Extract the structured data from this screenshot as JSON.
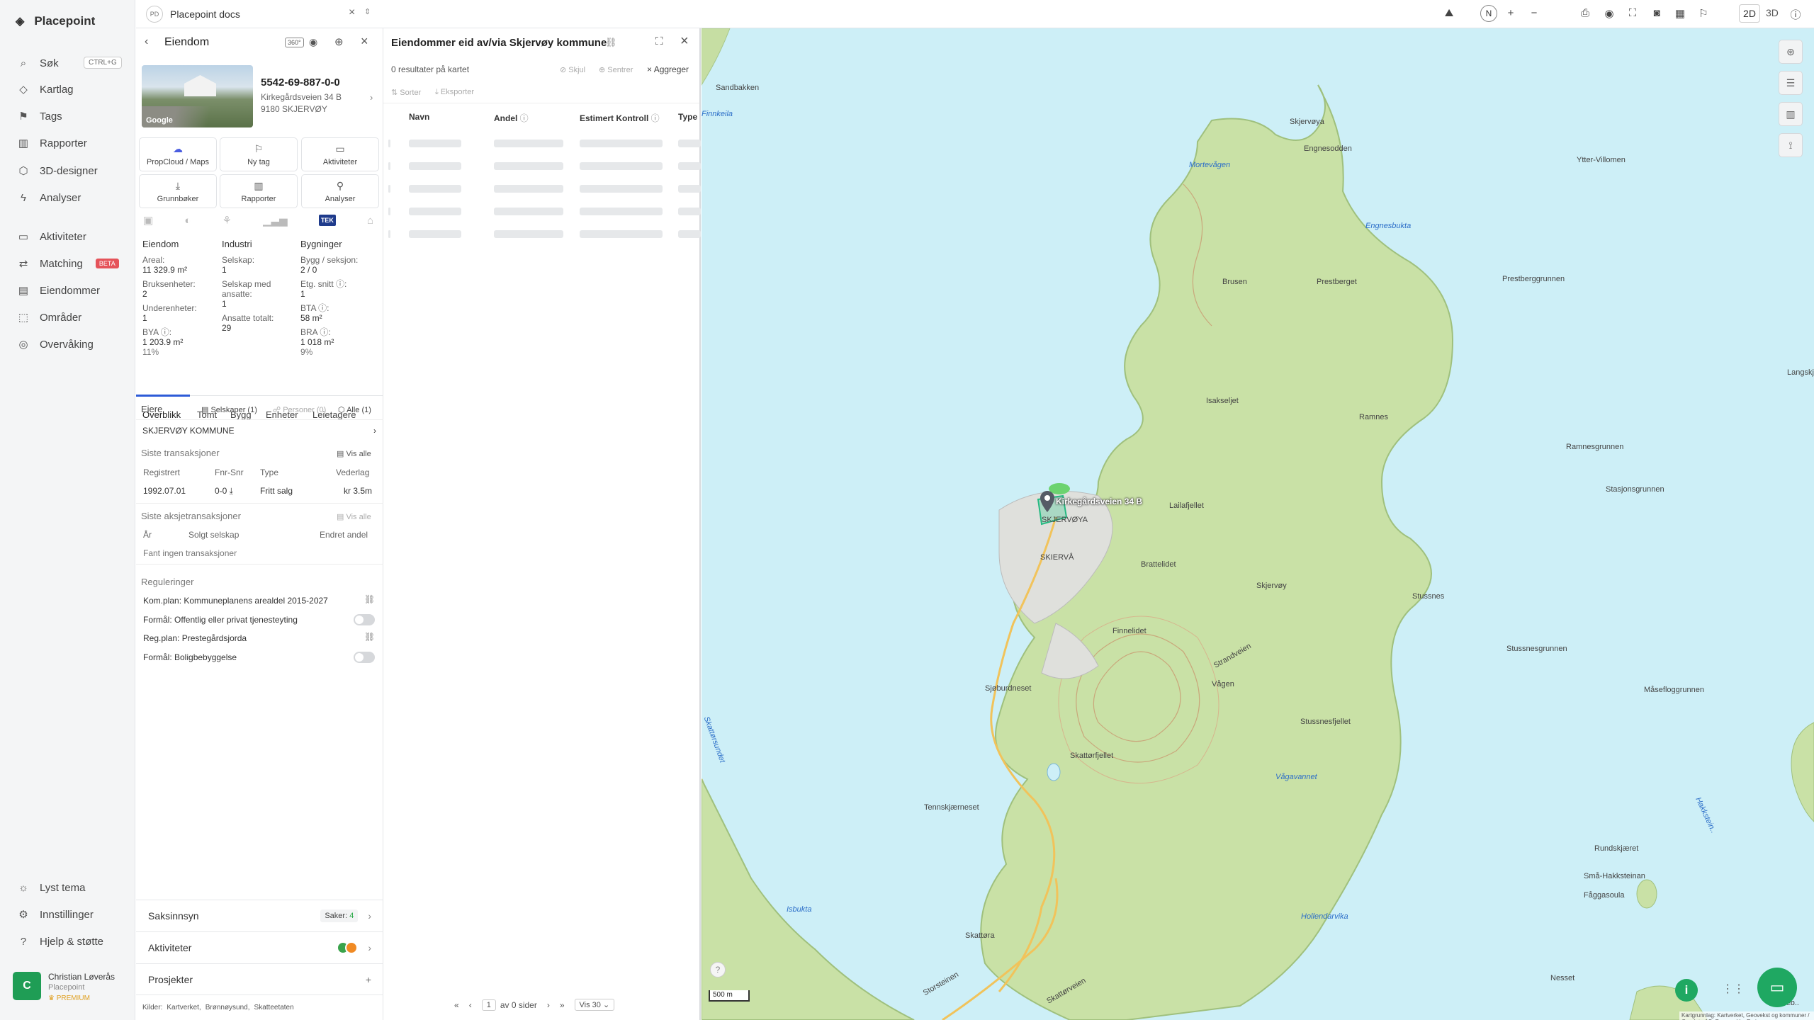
{
  "nav": {
    "brand": "Placepoint",
    "items": [
      {
        "label": "Søk",
        "icon": "search-icon"
      },
      {
        "label": "Kartlag",
        "icon": "layers-icon"
      },
      {
        "label": "Tags",
        "icon": "tag-icon"
      },
      {
        "label": "Rapporter",
        "icon": "chart-icon"
      },
      {
        "label": "3D-designer",
        "icon": "cube-icon"
      },
      {
        "label": "Analyser",
        "icon": "bolt-icon"
      },
      {
        "label": "Aktiviteter",
        "icon": "chat-icon"
      },
      {
        "label": "Matching",
        "icon": "swap-icon"
      },
      {
        "label": "Eiendommer",
        "icon": "building-icon"
      },
      {
        "label": "Områder",
        "icon": "area-icon"
      },
      {
        "label": "Overvåking",
        "icon": "watch-icon"
      }
    ],
    "search_shortcut": "CTRL+G",
    "matching_badge": "BETA",
    "bottom": [
      {
        "label": "Lyst tema",
        "icon": "sun-icon"
      },
      {
        "label": "Innstillinger",
        "icon": "gear-icon"
      },
      {
        "label": "Hjelp & støtte",
        "icon": "help-icon"
      }
    ],
    "user": {
      "initial": "C",
      "name": "Christian Løverås",
      "org": "Placepoint",
      "plan": "PREMIUM"
    }
  },
  "workspace": {
    "initials": "PD",
    "name": "Placepoint docs"
  },
  "detail": {
    "title": "Eiendom",
    "badge": "360°",
    "image_label": "Google",
    "id": "5542-69-887-0-0",
    "address": "Kirkegårdsveien 34 B",
    "postal": "9180 SKJERVØY",
    "actions": [
      {
        "label": "PropCloud / Maps",
        "icon": "cloud-icon"
      },
      {
        "label": "Ny tag",
        "icon": "tag-icon"
      },
      {
        "label": "Aktiviteter",
        "icon": "chat-icon"
      },
      {
        "label": "Grunnbøker",
        "icon": "download-icon"
      },
      {
        "label": "Rapporter",
        "icon": "chart-icon"
      },
      {
        "label": "Analyser",
        "icon": "pin-icon"
      }
    ],
    "tek_label": "TEK",
    "cols": {
      "eiendom": {
        "head": "Eiendom",
        "areal_l": "Areal:",
        "areal_v": "11 329.9 m²",
        "brukse_l": "Bruksenheter:",
        "brukse_v": "2",
        "under_l": "Underenheter:",
        "under_v": "1",
        "bya_l": "BYA ⓘ:",
        "bya_v": "1 203.9 m²",
        "bya_pct": "11%"
      },
      "industri": {
        "head": "Industri",
        "sel_l": "Selskap:",
        "sel_v": "1",
        "selans_l": "Selskap med ansatte:",
        "selans_v": "1",
        "ans_l": "Ansatte totalt:",
        "ans_v": "29"
      },
      "bygninger": {
        "head": "Bygninger",
        "bygg_l": "Bygg / seksjon:",
        "bygg_v": "2 / 0",
        "etg_l": "Etg. snitt ⓘ:",
        "etg_v": "1",
        "bta_l": "BTA ⓘ:",
        "bta_v": "58 m²",
        "bra_l": "BRA ⓘ:",
        "bra_v": "1 018 m²",
        "bra_pct": "9%"
      }
    },
    "tabs": [
      "Overblikk",
      "Tomt",
      "Bygg",
      "Enheter",
      "Leietagere"
    ],
    "eiere": {
      "title": "Eiere",
      "f1": "Selskaper (1)",
      "f2": "Personer (0)",
      "f3": "Alle (1)",
      "owner": "SKJERVØY KOMMUNE"
    },
    "trans": {
      "title": "Siste transaksjoner",
      "vis": "Vis alle",
      "h": [
        "Registrert",
        "Fnr-Snr",
        "Type",
        "Vederlag"
      ],
      "row": [
        "1992.07.01",
        "0-0",
        "Fritt salg",
        "kr 3.5m"
      ]
    },
    "aksje": {
      "title": "Siste aksjetransaksjoner",
      "vis": "Vis alle",
      "h": [
        "År",
        "Solgt selskap",
        "Endret andel"
      ],
      "empty": "Fant ingen transaksjoner"
    },
    "reg": {
      "title": "Reguleringer",
      "items": [
        "Kom.plan: Kommuneplanens arealdel 2015-2027",
        "Formål: Offentlig eller privat tjenesteyting",
        "Reg.plan: Prestegårdsjorda",
        "Formål: Boligbebyggelse"
      ]
    },
    "saksinnsyn": "Saksinnsyn",
    "saker_label": "Saker:",
    "saker_count": "4",
    "aktiviteter": "Aktiviteter",
    "prosjekter": "Prosjekter",
    "kilder": "Kilder:",
    "kilde_items": [
      "Kartverket,",
      "Brønnøysund,",
      "Skatteetaten"
    ]
  },
  "list": {
    "title": "Eiendommer eid av/via Skjervøy kommune",
    "results": "0 resultater på kartet",
    "skjul": "Skjul",
    "sentrer": "Sentrer",
    "aggreger": "Aggreger",
    "sorter": "Sorter",
    "eksporter": "Eksporter",
    "cols": [
      "Navn",
      "Andel",
      "Estimert Kontroll",
      "Type"
    ],
    "page_value": "1",
    "page_of": "av 0 sider",
    "per_page": "Vis 30"
  },
  "map": {
    "mode2d": "2D",
    "mode3d": "3D",
    "north": "N",
    "scale": "500 m",
    "attribution": "Kartgrunnlag: Kartverket, Geovekst og kommuner / Geodata AS, Powered by Esri",
    "labels_land": [
      "Sandbakken",
      "Skjervøya",
      "Engnesodden",
      "Ytter-Villomen",
      "Prestberget",
      "Brusen",
      "Prestberggrunnen",
      "Isakseljet",
      "Ramnes",
      "Ramnesgrunnen",
      "Stasjonsgrunnen",
      "Lailafjellet",
      "SKJERVØYA",
      "SKIERVÅ",
      "Brattelidet",
      "Skjervøy",
      "Stussnes",
      "Finnelidet",
      "Strandveien",
      "Stussnesgrunnen",
      "Måsefloggrunnen",
      "Sjøburdneset",
      "Vågen",
      "Stussnesfjellet",
      "Skattørfjellet",
      "Tennskjærneset",
      "Skattøra",
      "Nesset",
      "Skattørveien",
      "Storsteinen",
      "Rundskjæret",
      "Små-Hakksteinan",
      "Fåggasoula",
      "Langskj..",
      "Taskeb.."
    ],
    "labels_water": [
      "Finnkeila",
      "Mortevågen",
      "Engnesbukta",
      "Skattørsundet",
      "Vågavannet",
      "Isbukta",
      "Hollendarvika",
      "Hakkstein.."
    ],
    "pin_label": "Kirkegårdsveien 34 B"
  }
}
